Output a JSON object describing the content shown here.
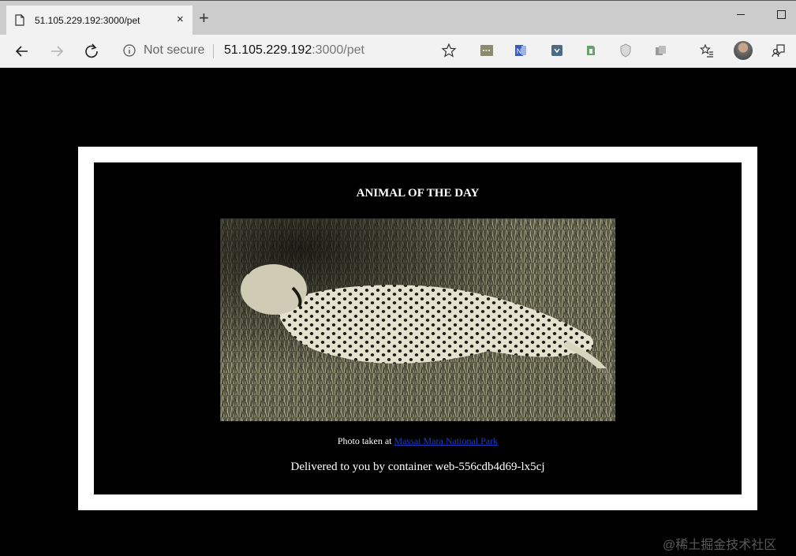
{
  "browser": {
    "tab_title": "51.105.229.192:3000/pet",
    "tab_close": "×",
    "new_tab": "+",
    "security_label": "Not secure",
    "url_host": "51.105.229.192",
    "url_rest": ":3000/pet"
  },
  "page": {
    "heading": "ANIMAL OF THE DAY",
    "caption_prefix": "Photo taken at ",
    "caption_link": "Massai Mara National Park",
    "delivered": "Delivered to you by container web-556cdb4d69-lx5cj"
  },
  "watermark": "@稀土掘金技术社区",
  "colors": {
    "page_bg": "#000000",
    "frame": "#ffffff",
    "link": "#1a3fc4"
  }
}
